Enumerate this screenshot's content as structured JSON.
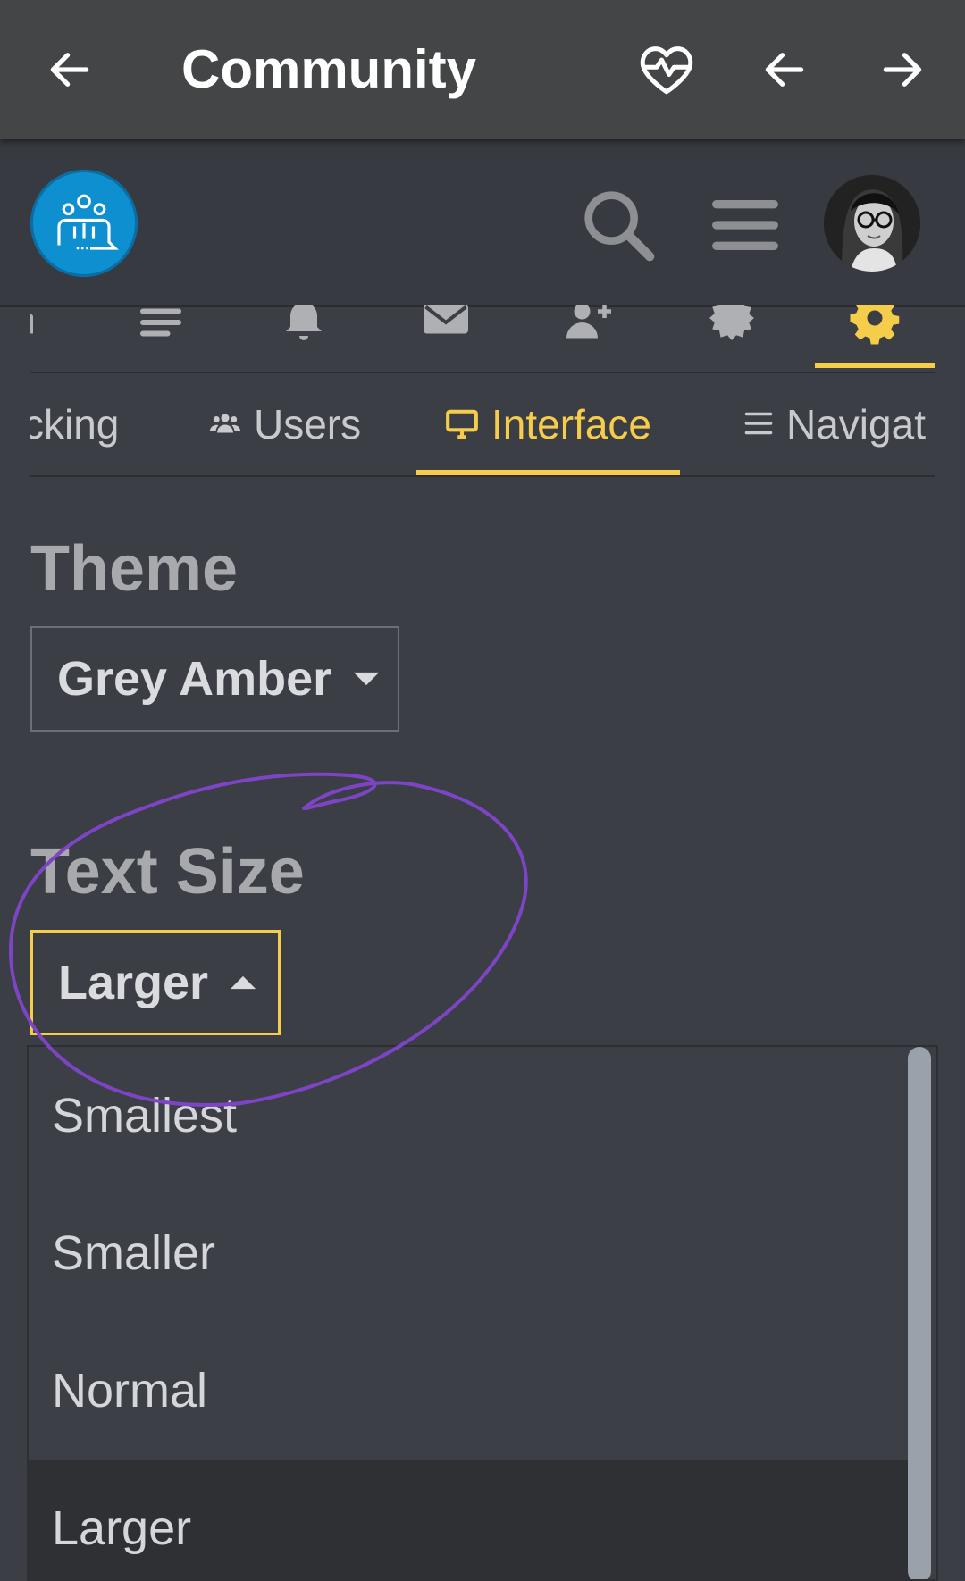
{
  "app_bar": {
    "title": "Community",
    "back_icon": "arrow-left-icon",
    "health_icon": "heart-pulse-icon",
    "nav_back_icon": "arrow-left-icon",
    "nav_forward_icon": "arrow-right-icon"
  },
  "site_header": {
    "logo_icon": "community-logo-icon",
    "search_icon": "search-icon",
    "menu_icon": "hamburger-menu-icon",
    "avatar": "user-avatar"
  },
  "icon_tabs": [
    {
      "icon": "partial-icon"
    },
    {
      "icon": "list-icon"
    },
    {
      "icon": "bell-icon"
    },
    {
      "icon": "envelope-icon"
    },
    {
      "icon": "user-plus-icon"
    },
    {
      "icon": "badge-icon"
    },
    {
      "icon": "gear-icon",
      "active": true
    }
  ],
  "text_tabs": [
    {
      "label": "cking",
      "icon": ""
    },
    {
      "label": "Users",
      "icon": "users-icon"
    },
    {
      "label": "Interface",
      "icon": "monitor-icon",
      "active": true
    },
    {
      "label": "Navigat",
      "icon": "bars-icon"
    }
  ],
  "theme": {
    "label": "Theme",
    "value": "Grey Amber"
  },
  "text_size": {
    "label": "Text Size",
    "value": "Larger",
    "options": [
      "Smallest",
      "Smaller",
      "Normal",
      "Larger"
    ]
  },
  "colors": {
    "accent": "#f6cd4b",
    "background": "#3b3e45",
    "app_bar": "#444546",
    "annotation": "#7d45c6"
  }
}
